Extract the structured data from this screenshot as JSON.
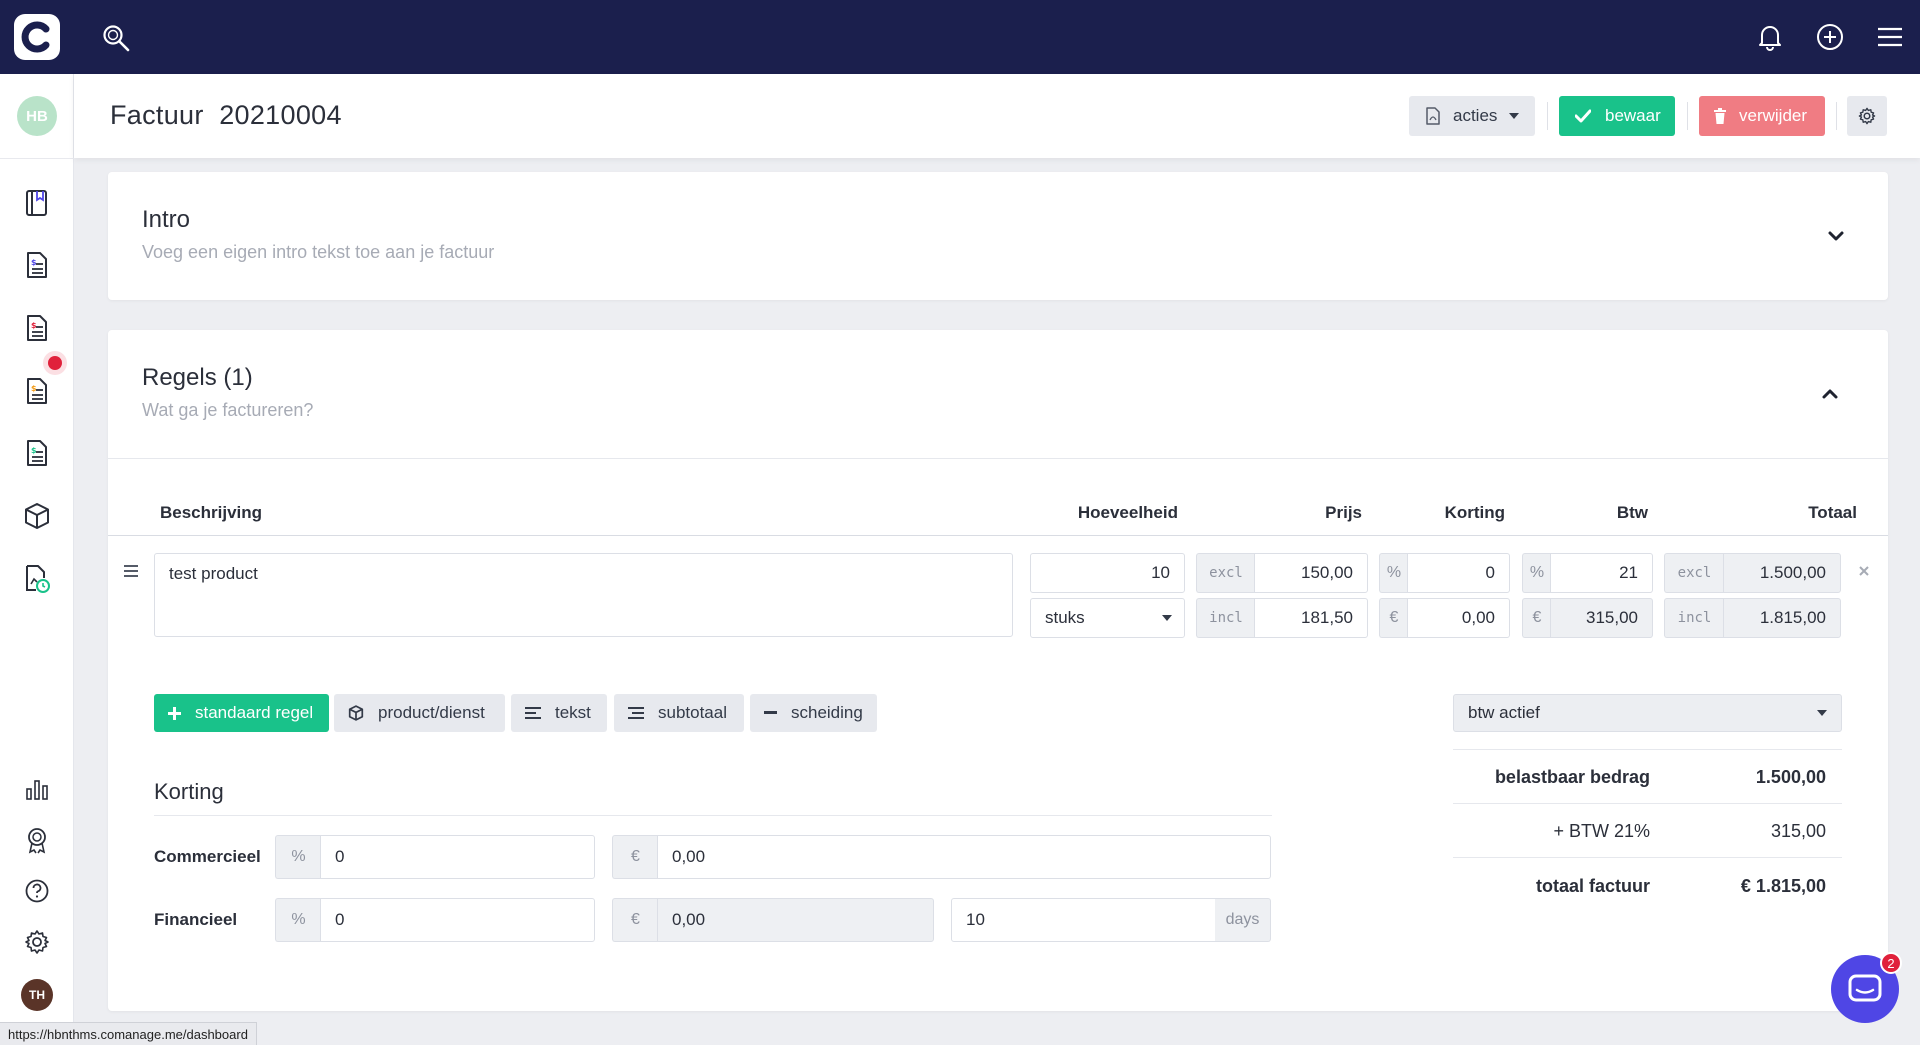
{
  "header": {
    "title": "Factuur  20210004",
    "acties_label": "acties",
    "bewaar_label": "bewaar",
    "verwijder_label": "verwijder"
  },
  "sidebar": {
    "user_initials": "HB",
    "footer_initials": "TH"
  },
  "intro": {
    "title": "Intro",
    "subtitle": "Voeg een eigen intro tekst toe aan je factuur"
  },
  "regels": {
    "title": "Regels  (1)",
    "subtitle": "Wat ga je factureren?",
    "columns": [
      "Beschrijving",
      "Hoeveelheid",
      "Prijs",
      "Korting",
      "Btw",
      "Totaal"
    ],
    "line": {
      "description": "test product",
      "quantity": "10",
      "unit": "stuks",
      "price_excl_label": "excl",
      "price_excl": "150,00",
      "price_incl_label": "incl",
      "price_incl": "181,50",
      "discount_pct_symbol": "%",
      "discount_pct": "0",
      "discount_eur_symbol": "€",
      "discount_eur": "0,00",
      "btw_pct_symbol": "%",
      "btw_pct": "21",
      "btw_eur_symbol": "€",
      "btw_eur": "315,00",
      "total_excl_label": "excl",
      "total_excl": "1.500,00",
      "total_incl_label": "incl",
      "total_incl": "1.815,00"
    },
    "add_buttons": {
      "standaard": "standaard regel",
      "product": "product/dienst",
      "tekst": "tekst",
      "subtotaal": "subtotaal",
      "scheiding": "scheiding"
    },
    "btw_select": "btw actief"
  },
  "korting": {
    "title": "Korting",
    "commercieel": {
      "label": "Commercieel",
      "pct_symbol": "%",
      "pct": "0",
      "eur_symbol": "€",
      "eur": "0,00"
    },
    "financieel": {
      "label": "Financieel",
      "pct_symbol": "%",
      "pct": "0",
      "eur_symbol": "€",
      "eur": "0,00",
      "days": "10",
      "days_label": "days"
    }
  },
  "summary": {
    "belastbaar_label": "belastbaar bedrag",
    "belastbaar_value": "1.500,00",
    "btw_label": "+ BTW 21%",
    "btw_value": "315,00",
    "totaal_label": "totaal factuur",
    "totaal_value": "€ 1.815,00"
  },
  "status_url": "https://hbnthms.comanage.me/dashboard",
  "chat_badge": "2",
  "colors": {
    "topbar": "#1b1f4d",
    "green": "#19c28a",
    "red": "#f07c83",
    "notification": "#e0213b",
    "chat": "#4f46e5"
  }
}
